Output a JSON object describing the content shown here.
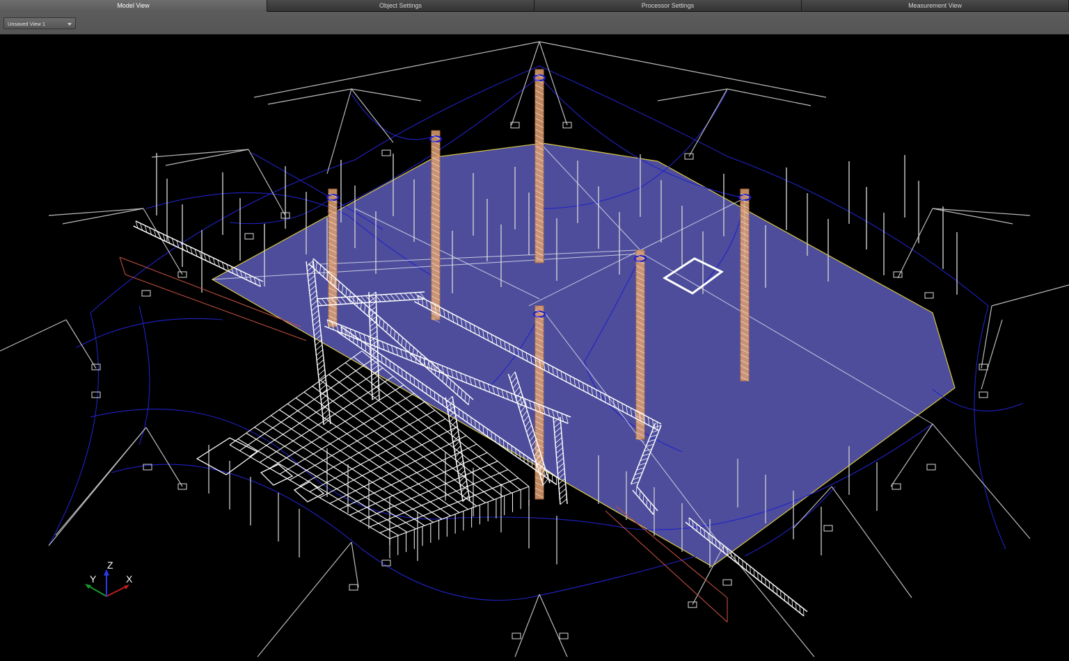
{
  "tabs": [
    {
      "label": "Model View",
      "active": true
    },
    {
      "label": "Object Settings",
      "active": false
    },
    {
      "label": "Processor Settings",
      "active": false
    },
    {
      "label": "Measurement View",
      "active": false
    }
  ],
  "toolbar": {
    "view_select": {
      "value": "Unsaved View 1"
    }
  },
  "viewport": {
    "axes": {
      "x_label": "X",
      "y_label": "Y",
      "z_label": "Z"
    }
  },
  "colors": {
    "background": "#000000",
    "floor": "#6b6bd8",
    "cable": "#2222c8",
    "mast": "#e0a070",
    "truss": "#ffffff",
    "rigging": "#bdbdbd",
    "room_outline": "#c05040"
  }
}
